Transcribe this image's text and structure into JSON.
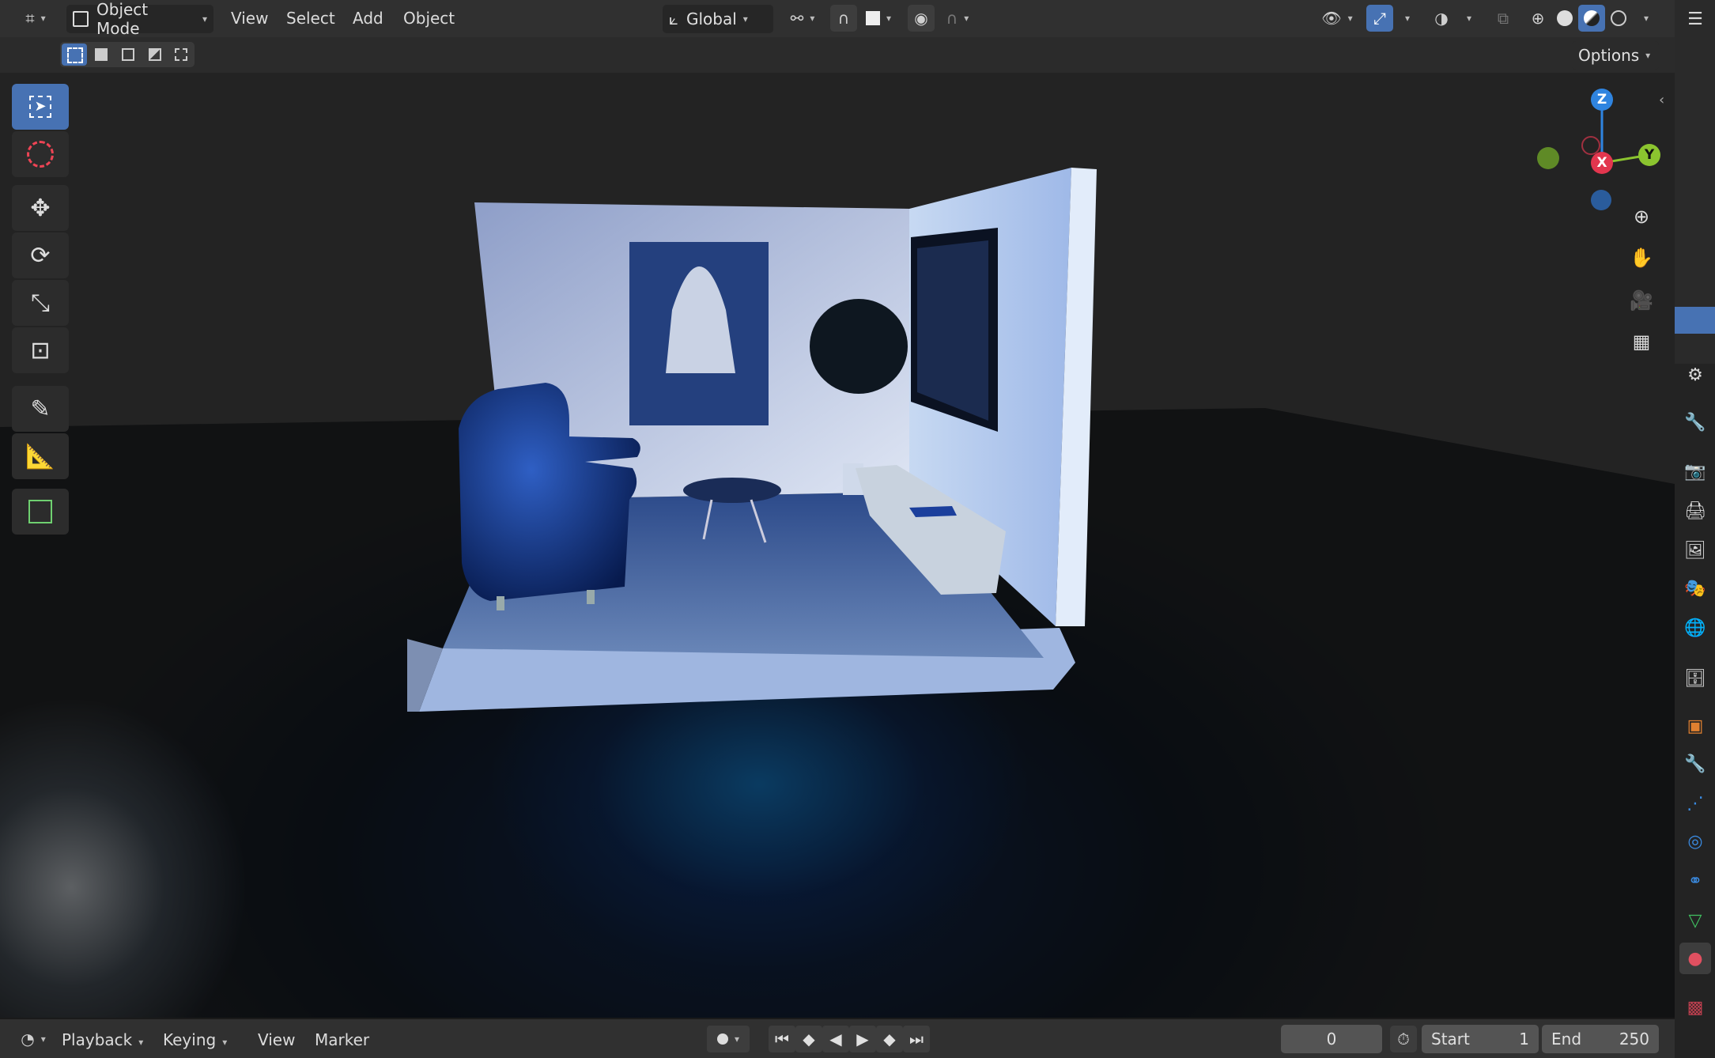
{
  "header": {
    "mode_label": "Object Mode",
    "menus": [
      "View",
      "Select",
      "Add",
      "Object"
    ],
    "orientation_label": "Global",
    "options_label": "Options"
  },
  "gizmo": {
    "z": "Z",
    "y": "Y",
    "x": "X"
  },
  "timeline": {
    "menus": [
      "Playback",
      "Keying",
      "View",
      "Marker"
    ],
    "current_frame": "0",
    "start_label": "Start",
    "start_value": "1",
    "end_label": "End",
    "end_value": "250"
  },
  "colors": {
    "accent": "#4772b3",
    "axis_x": "#e2364e",
    "axis_y": "#8bc42f",
    "axis_z": "#2f84e0"
  }
}
